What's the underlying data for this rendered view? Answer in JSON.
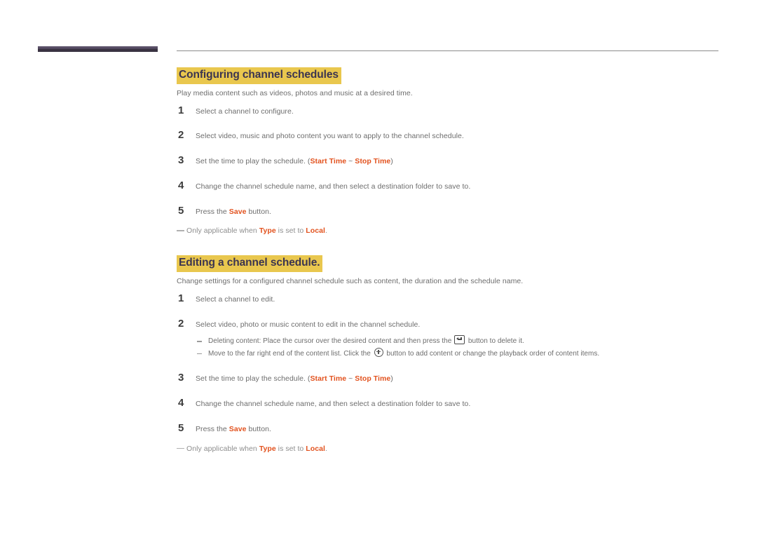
{
  "page": {
    "accent_highlight": "#e9c74e",
    "heading_text_color": "#3b3450",
    "emphasis_color": "#e2521e",
    "body_text_color": "#6d6d6d",
    "rule_bar_color": "#3a3342"
  },
  "sections": [
    {
      "heading": "Configuring channel schedules",
      "intro": "Play media content such as videos, photos and music at a desired time.",
      "steps": [
        {
          "number": "1",
          "parts": [
            {
              "type": "text",
              "value": "Select a channel to configure."
            }
          ]
        },
        {
          "number": "2",
          "parts": [
            {
              "type": "text",
              "value": "Select video, music and photo content you want to apply to the channel schedule."
            }
          ]
        },
        {
          "number": "3",
          "parts": [
            {
              "type": "text",
              "value": "Set the time to play the schedule. ("
            },
            {
              "type": "emph",
              "value": "Start Time"
            },
            {
              "type": "text",
              "value": " ~ "
            },
            {
              "type": "emph",
              "value": "Stop Time"
            },
            {
              "type": "text",
              "value": ")"
            }
          ]
        },
        {
          "number": "4",
          "parts": [
            {
              "type": "text",
              "value": "Change the channel schedule name, and then select a destination folder to save to."
            }
          ]
        },
        {
          "number": "5",
          "parts": [
            {
              "type": "text",
              "value": "Press the "
            },
            {
              "type": "emph",
              "value": "Save"
            },
            {
              "type": "text",
              "value": " button."
            }
          ]
        }
      ],
      "note": {
        "parts": [
          {
            "type": "text",
            "value": "Only applicable when "
          },
          {
            "type": "emph",
            "value": "Type"
          },
          {
            "type": "text",
            "value": " is set to "
          },
          {
            "type": "emph",
            "value": "Local"
          },
          {
            "type": "text",
            "value": "."
          }
        ]
      }
    },
    {
      "heading": "Editing a channel schedule.",
      "intro": "Change settings for a configured channel schedule such as content, the duration and the schedule name.",
      "steps": [
        {
          "number": "1",
          "parts": [
            {
              "type": "text",
              "value": "Select a channel to edit."
            }
          ]
        },
        {
          "number": "2",
          "parts": [
            {
              "type": "text",
              "value": "Select video, photo or music content to edit in the channel schedule."
            }
          ],
          "subitems": [
            {
              "parts": [
                {
                  "type": "text",
                  "value": "Deleting content: Place the cursor over the desired content and then press the "
                },
                {
                  "type": "icon",
                  "value": "return-enter-icon"
                },
                {
                  "type": "text",
                  "value": " button to delete it."
                }
              ]
            },
            {
              "parts": [
                {
                  "type": "text",
                  "value": "Move to the far right end of the content list. Click the "
                },
                {
                  "type": "icon",
                  "value": "plus-circle-icon"
                },
                {
                  "type": "text",
                  "value": " button to add content or change the playback order of content items."
                }
              ]
            }
          ]
        },
        {
          "number": "3",
          "parts": [
            {
              "type": "text",
              "value": "Set the time to play the schedule. ("
            },
            {
              "type": "emph",
              "value": "Start Time"
            },
            {
              "type": "text",
              "value": " ~ "
            },
            {
              "type": "emph",
              "value": "Stop Time"
            },
            {
              "type": "text",
              "value": ")"
            }
          ]
        },
        {
          "number": "4",
          "parts": [
            {
              "type": "text",
              "value": "Change the channel schedule name, and then select a destination folder to save to."
            }
          ]
        },
        {
          "number": "5",
          "parts": [
            {
              "type": "text",
              "value": "Press the "
            },
            {
              "type": "emph",
              "value": "Save"
            },
            {
              "type": "text",
              "value": " button."
            }
          ]
        }
      ],
      "note": {
        "parts": [
          {
            "type": "text",
            "value": "Only applicable when "
          },
          {
            "type": "emph",
            "value": "Type"
          },
          {
            "type": "text",
            "value": " is set to "
          },
          {
            "type": "emph",
            "value": "Local"
          },
          {
            "type": "text",
            "value": "."
          }
        ]
      }
    }
  ]
}
